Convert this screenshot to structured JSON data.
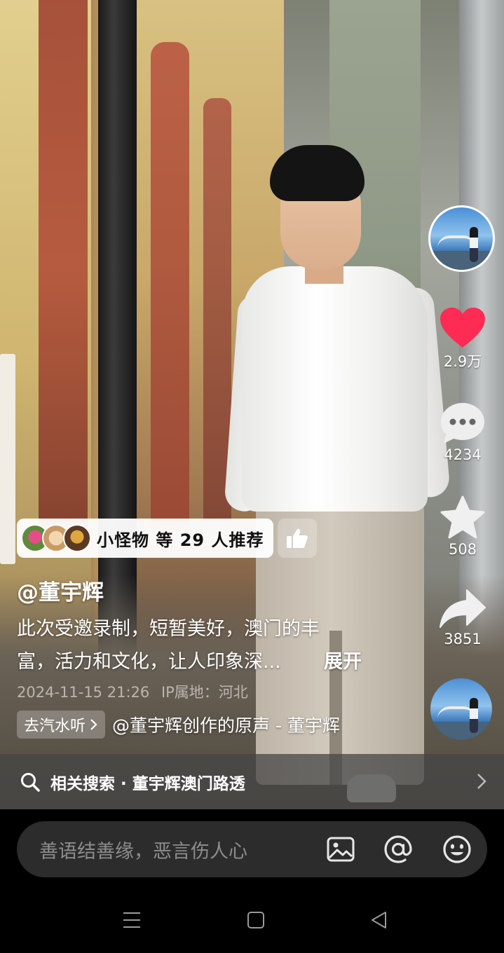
{
  "video": {
    "recommend": {
      "text": "小怪物 等 29 人推荐"
    },
    "author": "@董宇辉",
    "description": {
      "line1": "此次受邀录制，短暂美好，澳门的丰",
      "line2": "富，活力和文化，让人印象深..."
    },
    "expand_label": "展开",
    "meta": {
      "datetime": "2024-11-15 21:26",
      "location": "IP属地：河北"
    },
    "music": {
      "go_listen": "去汽水听",
      "name": "@董宇辉创作的原声 - 董宇辉"
    },
    "related_search": "相关搜索 · 董宇辉澳门路透"
  },
  "actions": {
    "like_count": "2.9万",
    "comment_count": "4234",
    "favorite_count": "508",
    "share_count": "3851"
  },
  "comment_bar": {
    "placeholder": "善语结善缘，恶言伤人心"
  },
  "colors": {
    "like": "#fe2c55",
    "bg": "#000000",
    "input_bg": "#2c2c2c"
  },
  "icons": [
    "heart-icon",
    "comment-icon",
    "star-icon",
    "share-icon",
    "thumbs-up-icon",
    "search-icon",
    "chevron-right-icon",
    "image-icon",
    "at-icon",
    "emoji-icon",
    "menu-icon",
    "home-icon",
    "back-icon"
  ]
}
